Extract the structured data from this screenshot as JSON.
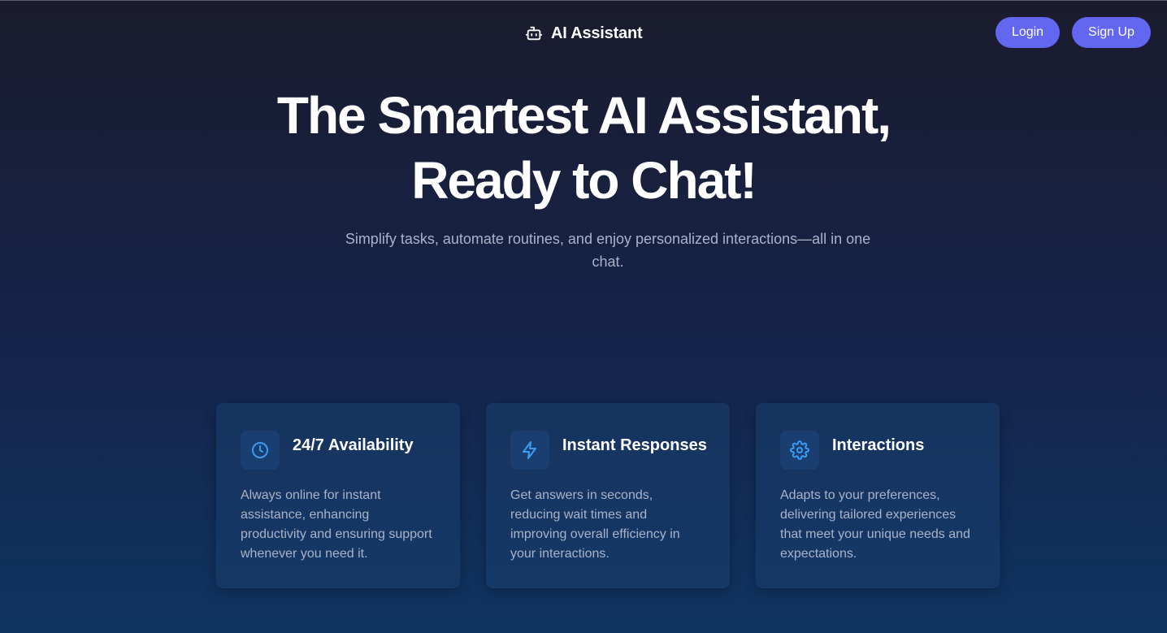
{
  "header": {
    "brand_icon": "robot-icon",
    "brand_name": "AI Assistant",
    "login_label": "Login",
    "signup_label": "Sign Up"
  },
  "hero": {
    "title_line1": "The Smartest AI Assistant,",
    "title_line2": "Ready to Chat!",
    "subtitle": "Simplify tasks, automate routines, and enjoy personalized interactions—all in one chat."
  },
  "features": [
    {
      "icon": "clock-icon",
      "title": "24/7 Availability",
      "description": "Always online for instant assistance, enhancing productivity and ensuring support whenever you need it."
    },
    {
      "icon": "lightning-icon",
      "title": "Instant Responses",
      "description": "Get answers in seconds, reducing wait times and improving overall efficiency in your interactions."
    },
    {
      "icon": "gear-icon",
      "title": "Interactions",
      "description": "Adapts to your preferences, delivering tailored experiences that meet your unique needs and expectations."
    }
  ],
  "colors": {
    "accent": "#6366f1",
    "icon_blue": "#3b9cf5",
    "muted_text": "#a9b3c9"
  }
}
